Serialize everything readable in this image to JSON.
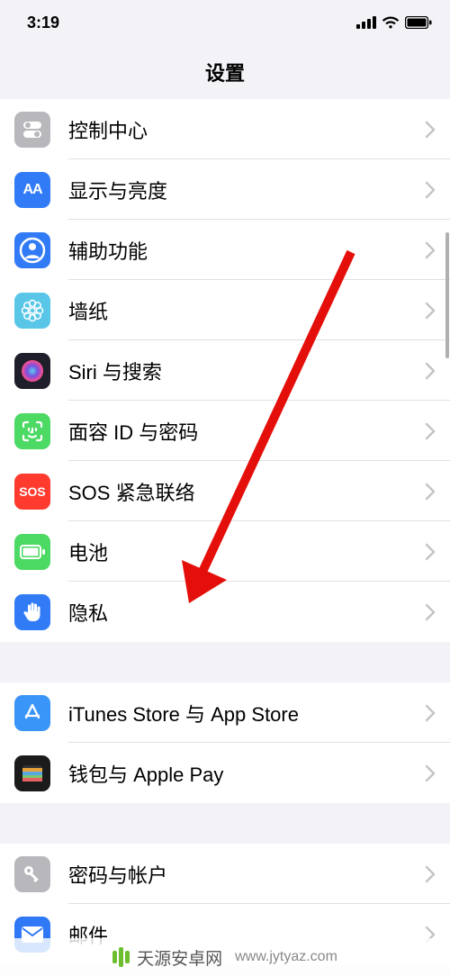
{
  "status": {
    "time": "3:19"
  },
  "header": {
    "title": "设置"
  },
  "groups": [
    {
      "rows": [
        {
          "id": "control-center",
          "label": "控制中心",
          "icon": "toggles",
          "bg": "#b7b7bc",
          "fg": "#fff"
        },
        {
          "id": "display-brightness",
          "label": "显示与亮度",
          "icon": "AA",
          "bg": "#317cf6",
          "fg": "#fff"
        },
        {
          "id": "accessibility",
          "label": "辅助功能",
          "icon": "person-circle",
          "bg": "#327bf6",
          "fg": "#fff"
        },
        {
          "id": "wallpaper",
          "label": "墙纸",
          "icon": "flower",
          "bg": "#59c6e8",
          "fg": "#fff"
        },
        {
          "id": "siri-search",
          "label": "Siri 与搜索",
          "icon": "siri",
          "bg": "#1f1f2b",
          "fg": "#fff"
        },
        {
          "id": "faceid-passcode",
          "label": "面容 ID 与密码",
          "icon": "faceid",
          "bg": "#4cd964",
          "fg": "#fff"
        },
        {
          "id": "sos",
          "label": "SOS 紧急联络",
          "icon": "sos-text",
          "bg": "#ff3b30",
          "fg": "#fff"
        },
        {
          "id": "battery",
          "label": "电池",
          "icon": "battery",
          "bg": "#4cd964",
          "fg": "#fff"
        },
        {
          "id": "privacy",
          "label": "隐私",
          "icon": "hand",
          "bg": "#317cf6",
          "fg": "#fff"
        }
      ]
    },
    {
      "rows": [
        {
          "id": "itunes-app-store",
          "label": "iTunes Store 与 App Store",
          "icon": "appstore",
          "bg": "#3a95f8",
          "fg": "#fff"
        },
        {
          "id": "wallet-pay",
          "label": "钱包与 Apple Pay",
          "icon": "wallet",
          "bg": "#1b1b1b",
          "fg": "#fff"
        }
      ]
    },
    {
      "rows": [
        {
          "id": "passwords-accounts",
          "label": "密码与帐户",
          "icon": "key",
          "bg": "#b7b7bc",
          "fg": "#fff"
        },
        {
          "id": "mail",
          "label": "邮件",
          "icon": "mail",
          "bg": "#2f79f6",
          "fg": "#fff"
        }
      ]
    }
  ],
  "watermark": {
    "brand": "天源安卓网",
    "url": "www.jytyaz.com"
  }
}
